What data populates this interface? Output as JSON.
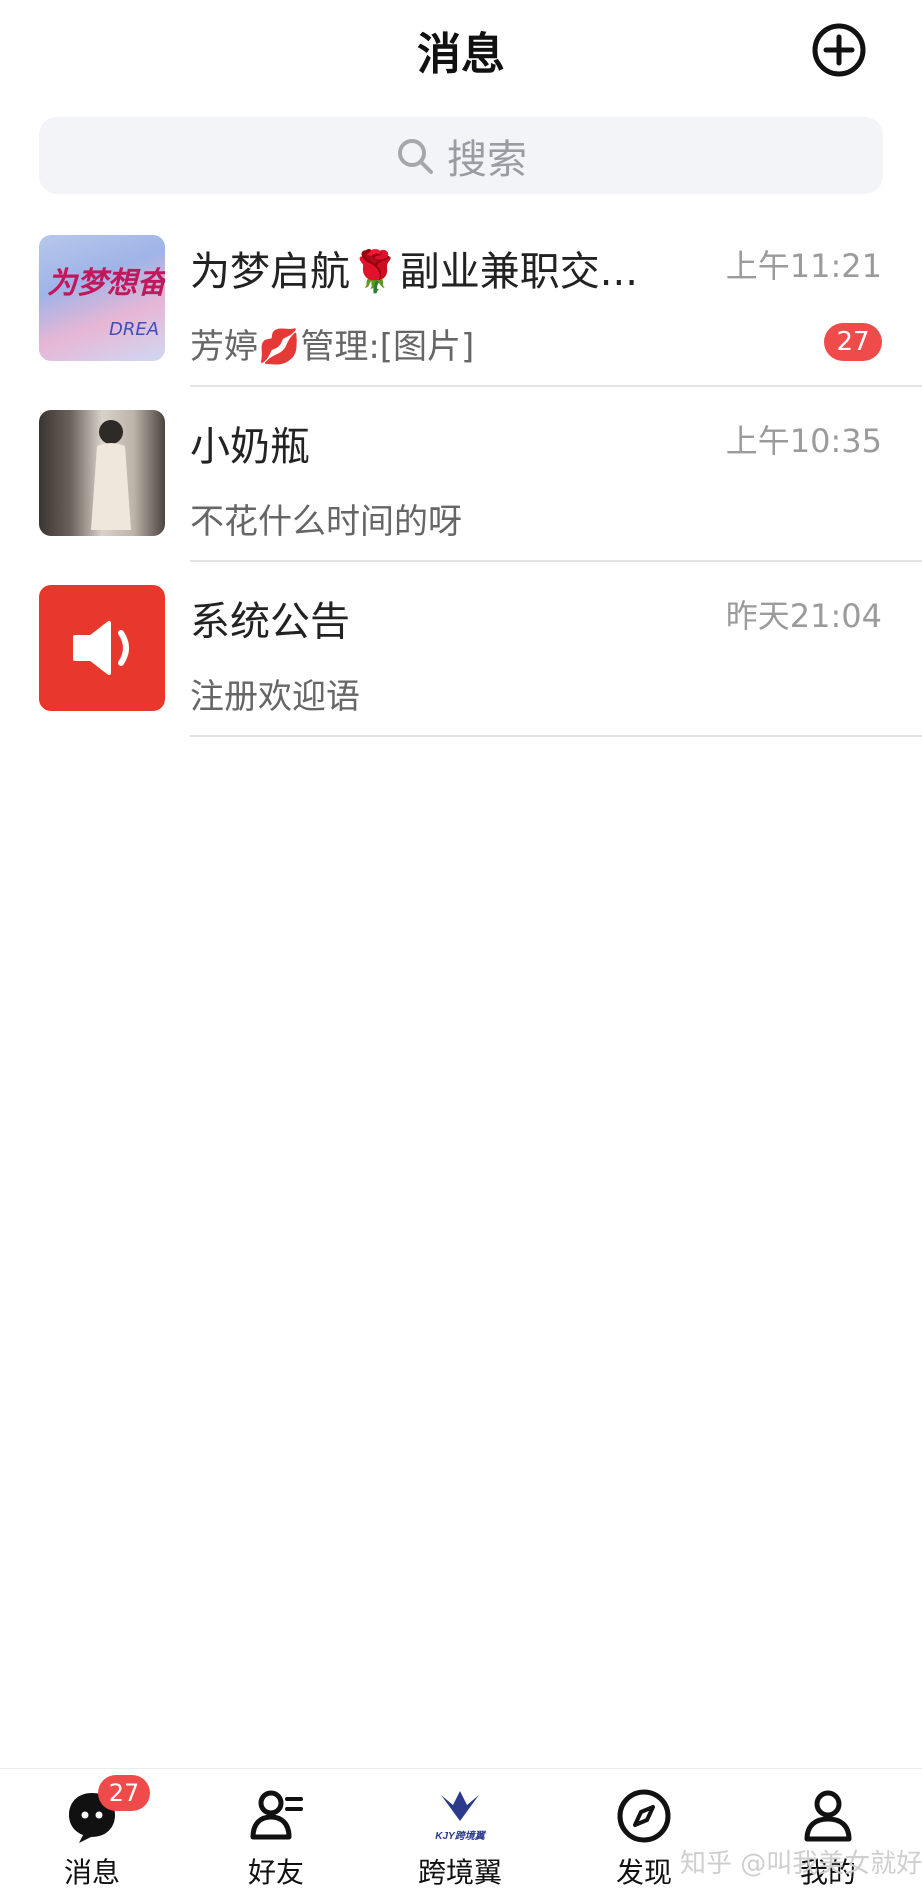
{
  "header": {
    "title": "消息",
    "add_icon": "plus-circle-icon"
  },
  "search": {
    "label": "搜索",
    "icon": "search-icon"
  },
  "conversations": [
    {
      "name": "为梦启航🌹副业兼职交...",
      "time": "上午11:21",
      "preview": "芳婷💋管理:[图片]",
      "unread": "27",
      "avatar_text": "为梦想奋斗"
    },
    {
      "name": "小奶瓶",
      "time": "上午10:35",
      "preview": "不花什么时间的呀",
      "unread": ""
    },
    {
      "name": "系统公告",
      "time": "昨天21:04",
      "preview": "注册欢迎语",
      "unread": "",
      "avatar_icon": "speaker-icon",
      "avatar_color": "#e8372c"
    }
  ],
  "tabbar": {
    "items": [
      {
        "label": "消息",
        "icon": "chat-bubble-icon",
        "badge": "27"
      },
      {
        "label": "好友",
        "icon": "friends-icon"
      },
      {
        "label": "跨境翼",
        "icon": "kjy-logo-icon",
        "logo_text": "KJY跨境翼"
      },
      {
        "label": "发现",
        "icon": "compass-icon"
      },
      {
        "label": "我的",
        "icon": "profile-icon"
      }
    ]
  },
  "watermark": "知乎 @叫我美女就好了"
}
